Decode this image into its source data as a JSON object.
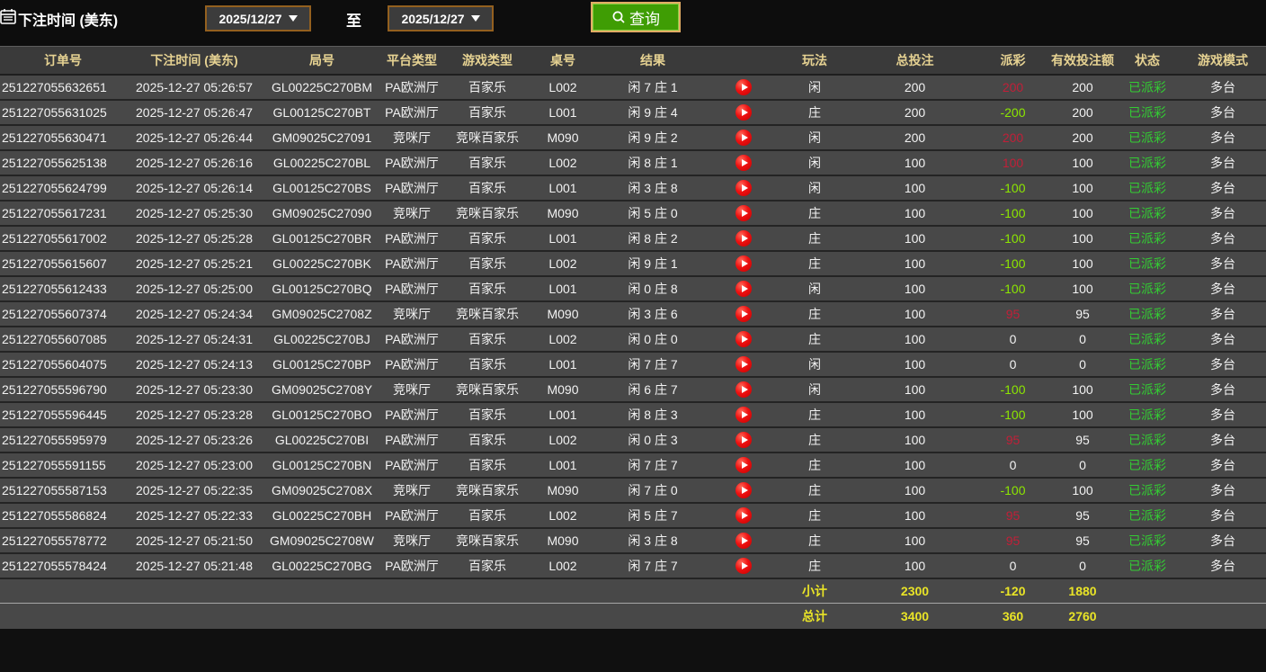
{
  "toolbar": {
    "title": "下注时间 (美东)",
    "date_from": "2025/12/27",
    "to_label": "至",
    "date_to": "2025/12/27",
    "query_label": "查询"
  },
  "colors": {
    "header_text": "#e6d292",
    "payout_positive": "#c11f38",
    "payout_negative": "#8ce600",
    "status_settled": "#33cc33",
    "summary_text": "#e9e427",
    "query_button_bg": "#3f9d04",
    "date_border": "#93601f"
  },
  "table": {
    "headers": [
      "订单号",
      "下注时间 (美东)",
      "局号",
      "平台类型",
      "游戏类型",
      "桌号",
      "结果",
      "",
      "玩法",
      "总投注",
      "派彩",
      "有效投注额",
      "状态",
      "游戏模式"
    ],
    "replay_icon": "play-circle",
    "rows": [
      {
        "order": "251227055632651",
        "time": "2025-12-27 05:26:57",
        "round": "GL00225C270BM",
        "platform": "PA欧洲厅",
        "game": "百家乐",
        "table_no": "L002",
        "result": "闲 7 庄 1",
        "play": "闲",
        "bet": "200",
        "payout": "200",
        "valid": "200",
        "status": "已派彩",
        "mode": "多台"
      },
      {
        "order": "251227055631025",
        "time": "2025-12-27 05:26:47",
        "round": "GL00125C270BT",
        "platform": "PA欧洲厅",
        "game": "百家乐",
        "table_no": "L001",
        "result": "闲 9 庄 4",
        "play": "庄",
        "bet": "200",
        "payout": "-200",
        "valid": "200",
        "status": "已派彩",
        "mode": "多台"
      },
      {
        "order": "251227055630471",
        "time": "2025-12-27 05:26:44",
        "round": "GM09025C27091",
        "platform": "竞咪厅",
        "game": "竞咪百家乐",
        "table_no": "M090",
        "result": "闲 9 庄 2",
        "play": "闲",
        "bet": "200",
        "payout": "200",
        "valid": "200",
        "status": "已派彩",
        "mode": "多台"
      },
      {
        "order": "251227055625138",
        "time": "2025-12-27 05:26:16",
        "round": "GL00225C270BL",
        "platform": "PA欧洲厅",
        "game": "百家乐",
        "table_no": "L002",
        "result": "闲 8 庄 1",
        "play": "闲",
        "bet": "100",
        "payout": "100",
        "valid": "100",
        "status": "已派彩",
        "mode": "多台"
      },
      {
        "order": "251227055624799",
        "time": "2025-12-27 05:26:14",
        "round": "GL00125C270BS",
        "platform": "PA欧洲厅",
        "game": "百家乐",
        "table_no": "L001",
        "result": "闲 3 庄 8",
        "play": "闲",
        "bet": "100",
        "payout": "-100",
        "valid": "100",
        "status": "已派彩",
        "mode": "多台"
      },
      {
        "order": "251227055617231",
        "time": "2025-12-27 05:25:30",
        "round": "GM09025C27090",
        "platform": "竞咪厅",
        "game": "竞咪百家乐",
        "table_no": "M090",
        "result": "闲 5 庄 0",
        "play": "庄",
        "bet": "100",
        "payout": "-100",
        "valid": "100",
        "status": "已派彩",
        "mode": "多台"
      },
      {
        "order": "251227055617002",
        "time": "2025-12-27 05:25:28",
        "round": "GL00125C270BR",
        "platform": "PA欧洲厅",
        "game": "百家乐",
        "table_no": "L001",
        "result": "闲 8 庄 2",
        "play": "庄",
        "bet": "100",
        "payout": "-100",
        "valid": "100",
        "status": "已派彩",
        "mode": "多台"
      },
      {
        "order": "251227055615607",
        "time": "2025-12-27 05:25:21",
        "round": "GL00225C270BK",
        "platform": "PA欧洲厅",
        "game": "百家乐",
        "table_no": "L002",
        "result": "闲 9 庄 1",
        "play": "庄",
        "bet": "100",
        "payout": "-100",
        "valid": "100",
        "status": "已派彩",
        "mode": "多台"
      },
      {
        "order": "251227055612433",
        "time": "2025-12-27 05:25:00",
        "round": "GL00125C270BQ",
        "platform": "PA欧洲厅",
        "game": "百家乐",
        "table_no": "L001",
        "result": "闲 0 庄 8",
        "play": "闲",
        "bet": "100",
        "payout": "-100",
        "valid": "100",
        "status": "已派彩",
        "mode": "多台"
      },
      {
        "order": "251227055607374",
        "time": "2025-12-27 05:24:34",
        "round": "GM09025C2708Z",
        "platform": "竞咪厅",
        "game": "竞咪百家乐",
        "table_no": "M090",
        "result": "闲 3 庄 6",
        "play": "庄",
        "bet": "100",
        "payout": "95",
        "valid": "95",
        "status": "已派彩",
        "mode": "多台"
      },
      {
        "order": "251227055607085",
        "time": "2025-12-27 05:24:31",
        "round": "GL00225C270BJ",
        "platform": "PA欧洲厅",
        "game": "百家乐",
        "table_no": "L002",
        "result": "闲 0 庄 0",
        "play": "庄",
        "bet": "100",
        "payout": "0",
        "valid": "0",
        "status": "已派彩",
        "mode": "多台"
      },
      {
        "order": "251227055604075",
        "time": "2025-12-27 05:24:13",
        "round": "GL00125C270BP",
        "platform": "PA欧洲厅",
        "game": "百家乐",
        "table_no": "L001",
        "result": "闲 7 庄 7",
        "play": "闲",
        "bet": "100",
        "payout": "0",
        "valid": "0",
        "status": "已派彩",
        "mode": "多台"
      },
      {
        "order": "251227055596790",
        "time": "2025-12-27 05:23:30",
        "round": "GM09025C2708Y",
        "platform": "竞咪厅",
        "game": "竞咪百家乐",
        "table_no": "M090",
        "result": "闲 6 庄 7",
        "play": "闲",
        "bet": "100",
        "payout": "-100",
        "valid": "100",
        "status": "已派彩",
        "mode": "多台"
      },
      {
        "order": "251227055596445",
        "time": "2025-12-27 05:23:28",
        "round": "GL00125C270BO",
        "platform": "PA欧洲厅",
        "game": "百家乐",
        "table_no": "L001",
        "result": "闲 8 庄 3",
        "play": "庄",
        "bet": "100",
        "payout": "-100",
        "valid": "100",
        "status": "已派彩",
        "mode": "多台"
      },
      {
        "order": "251227055595979",
        "time": "2025-12-27 05:23:26",
        "round": "GL00225C270BI",
        "platform": "PA欧洲厅",
        "game": "百家乐",
        "table_no": "L002",
        "result": "闲 0 庄 3",
        "play": "庄",
        "bet": "100",
        "payout": "95",
        "valid": "95",
        "status": "已派彩",
        "mode": "多台"
      },
      {
        "order": "251227055591155",
        "time": "2025-12-27 05:23:00",
        "round": "GL00125C270BN",
        "platform": "PA欧洲厅",
        "game": "百家乐",
        "table_no": "L001",
        "result": "闲 7 庄 7",
        "play": "庄",
        "bet": "100",
        "payout": "0",
        "valid": "0",
        "status": "已派彩",
        "mode": "多台"
      },
      {
        "order": "251227055587153",
        "time": "2025-12-27 05:22:35",
        "round": "GM09025C2708X",
        "platform": "竞咪厅",
        "game": "竞咪百家乐",
        "table_no": "M090",
        "result": "闲 7 庄 0",
        "play": "庄",
        "bet": "100",
        "payout": "-100",
        "valid": "100",
        "status": "已派彩",
        "mode": "多台"
      },
      {
        "order": "251227055586824",
        "time": "2025-12-27 05:22:33",
        "round": "GL00225C270BH",
        "platform": "PA欧洲厅",
        "game": "百家乐",
        "table_no": "L002",
        "result": "闲 5 庄 7",
        "play": "庄",
        "bet": "100",
        "payout": "95",
        "valid": "95",
        "status": "已派彩",
        "mode": "多台"
      },
      {
        "order": "251227055578772",
        "time": "2025-12-27 05:21:50",
        "round": "GM09025C2708W",
        "platform": "竞咪厅",
        "game": "竞咪百家乐",
        "table_no": "M090",
        "result": "闲 3 庄 8",
        "play": "庄",
        "bet": "100",
        "payout": "95",
        "valid": "95",
        "status": "已派彩",
        "mode": "多台"
      },
      {
        "order": "251227055578424",
        "time": "2025-12-27 05:21:48",
        "round": "GL00225C270BG",
        "platform": "PA欧洲厅",
        "game": "百家乐",
        "table_no": "L002",
        "result": "闲 7 庄 7",
        "play": "庄",
        "bet": "100",
        "payout": "0",
        "valid": "0",
        "status": "已派彩",
        "mode": "多台"
      }
    ],
    "subtotal": {
      "label": "小计",
      "bet": "2300",
      "payout": "-120",
      "valid": "1880"
    },
    "total": {
      "label": "总计",
      "bet": "3400",
      "payout": "360",
      "valid": "2760"
    }
  }
}
